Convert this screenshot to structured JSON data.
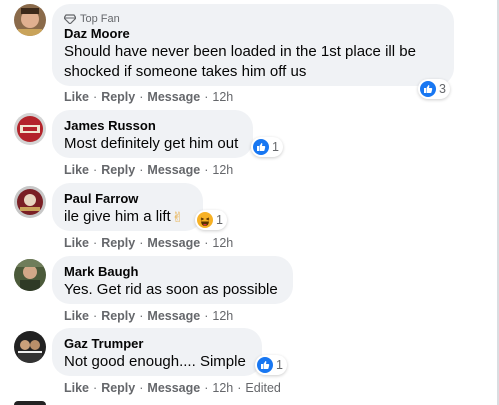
{
  "comments": [
    {
      "badge": "Top Fan",
      "name": "Daz Moore",
      "text": "Should have never been loaded in the 1st place ill be shocked if someone takes him off us",
      "reaction_count": "3",
      "time": "12h"
    },
    {
      "name": "James Russon",
      "text": "Most definitely get him out",
      "reaction_count": "1",
      "time": "12h"
    },
    {
      "name": "Paul Farrow",
      "text": "ile give him a lift",
      "text_emoji": "✌",
      "reaction_count": "1",
      "time": "12h"
    },
    {
      "name": "Mark Baugh",
      "text": "Yes. Get rid as soon as possible",
      "time": "12h"
    },
    {
      "name": "Gaz Trumper",
      "text": "Not good enough.... Simple",
      "reaction_count": "1",
      "time": "12h",
      "edited": "Edited"
    }
  ],
  "actions": {
    "like": "Like",
    "reply": "Reply",
    "message": "Message",
    "separator": "·"
  },
  "colors": {
    "accent": "#1877f2",
    "bubble": "#f0f2f5",
    "meta": "#65676b",
    "haha": "#f7b125"
  },
  "icons": {
    "badge": "diamond-icon",
    "like": "thumbs-up-icon",
    "haha": "laughing-face-icon"
  }
}
